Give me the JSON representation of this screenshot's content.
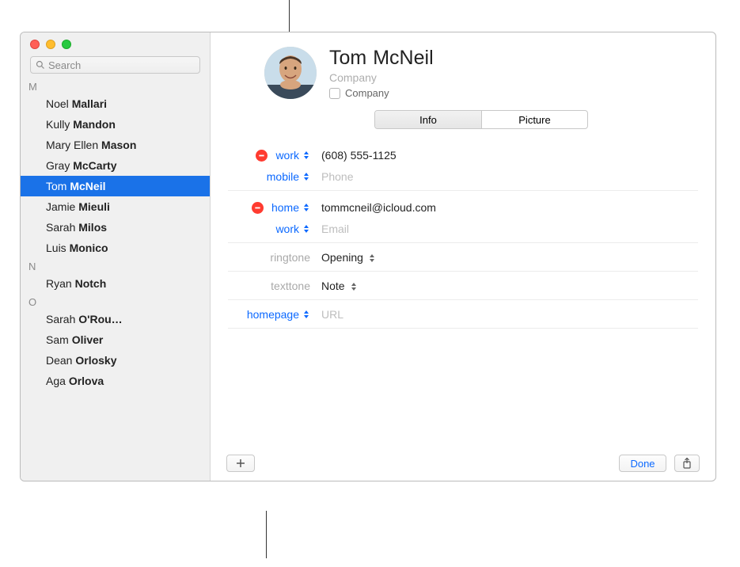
{
  "search": {
    "placeholder": "Search"
  },
  "sections": [
    {
      "letter": "M",
      "contacts": [
        {
          "first": "Noel",
          "last": "Mallari"
        },
        {
          "first": "Kully",
          "last": "Mandon"
        },
        {
          "first": "Mary Ellen",
          "last": "Mason"
        },
        {
          "first": "Gray",
          "last": "McCarty"
        },
        {
          "first": "Tom",
          "last": "McNeil",
          "selected": true
        },
        {
          "first": "Jamie",
          "last": "Mieuli"
        },
        {
          "first": "Sarah",
          "last": "Milos"
        },
        {
          "first": "Luis",
          "last": "Monico"
        }
      ]
    },
    {
      "letter": "N",
      "contacts": [
        {
          "first": "Ryan",
          "last": "Notch"
        }
      ]
    },
    {
      "letter": "O",
      "contacts": [
        {
          "first": "Sarah",
          "last": "O'Rou…"
        },
        {
          "first": "Sam",
          "last": "Oliver"
        },
        {
          "first": "Dean",
          "last": "Orlosky"
        },
        {
          "first": "Aga",
          "last": "Orlova"
        }
      ]
    }
  ],
  "card": {
    "first_name": "Tom",
    "last_name": "McNeil",
    "company_placeholder": "Company",
    "company_checkbox_label": "Company",
    "company_checked": false,
    "tabs": {
      "info": "Info",
      "picture": "Picture",
      "active": "info"
    },
    "fields": [
      {
        "type": "phone",
        "label": "work",
        "label_style": "link",
        "removable": true,
        "value": "(608) 555-1125"
      },
      {
        "type": "phone",
        "label": "mobile",
        "label_style": "link",
        "removable": false,
        "placeholder": "Phone",
        "divider": true
      },
      {
        "type": "email",
        "label": "home",
        "label_style": "link",
        "removable": true,
        "value": "tommcneil@icloud.com"
      },
      {
        "type": "email",
        "label": "work",
        "label_style": "link",
        "removable": false,
        "placeholder": "Email",
        "divider": true
      },
      {
        "type": "select",
        "label": "ringtone",
        "label_style": "gray",
        "value": "Opening",
        "value_stepper": true,
        "divider": true
      },
      {
        "type": "select",
        "label": "texttone",
        "label_style": "gray",
        "value": "Note",
        "value_stepper": true,
        "divider": true
      },
      {
        "type": "url",
        "label": "homepage",
        "label_style": "link",
        "removable": false,
        "placeholder": "URL",
        "divider": true
      }
    ]
  },
  "footer": {
    "done": "Done"
  },
  "icons": {
    "minus": "minus-icon",
    "stepper": "stepper-icon",
    "plus": "plus-icon",
    "share": "share-icon",
    "search": "search-icon"
  }
}
